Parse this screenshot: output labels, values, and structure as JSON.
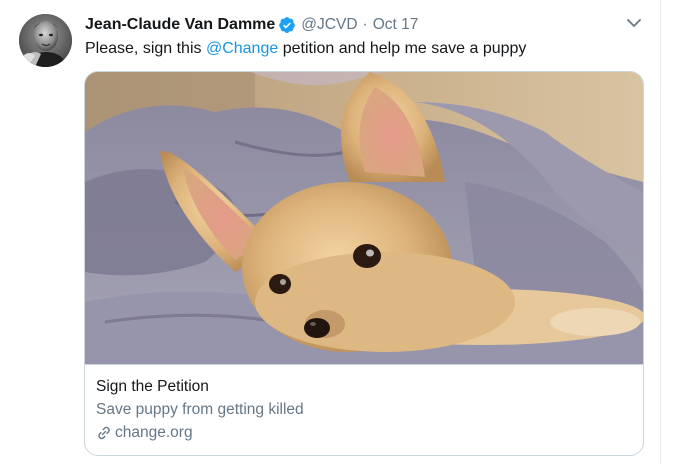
{
  "tweet": {
    "author": {
      "display_name": "Jean-Claude Van Damme",
      "handle": "@JCVD",
      "verified": true
    },
    "separator": "·",
    "date": "Oct 17",
    "text": {
      "before_mention": "Please, sign this ",
      "mention": "@Change",
      "after_mention": " petition and help me save a puppy"
    },
    "card": {
      "image_icon": "puppy-photo",
      "title": "Sign the Petition",
      "description": "Save puppy from getting killed",
      "domain": "change.org",
      "domain_icon": "link-icon"
    }
  },
  "colors": {
    "text_primary": "#14171a",
    "text_secondary": "#657786",
    "link_blue": "#1b95e0",
    "verified_blue": "#1da1f2",
    "border": "#ccd6dd"
  }
}
